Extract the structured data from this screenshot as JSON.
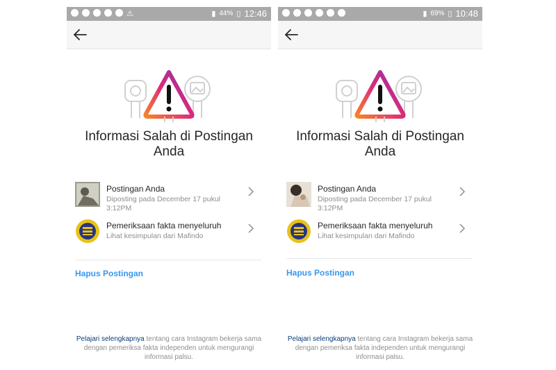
{
  "colors": {
    "statusbar": "#a9a9a9",
    "link_blue": "#3897f0",
    "text_dark": "#262626",
    "text_grey": "#8e8e8e",
    "warning_gradient": [
      "#f58529",
      "#dd2a7b",
      "#8134af"
    ]
  },
  "phones": [
    {
      "status": {
        "battery": "44%",
        "time": "12:46"
      },
      "icons": [
        "back-arrow-icon",
        "warning-triangle-icon",
        "chevron-right-icon"
      ],
      "title": "Informasi Salah di Postingan Anda",
      "post_row": {
        "title": "Postingan Anda",
        "subtitle": "Diposting pada December 17 pukul 3:12PM"
      },
      "factcheck_row": {
        "title": "Pemeriksaan fakta menyeluruh",
        "subtitle": "Lihat kesimpulan dari Mafindo"
      },
      "delete_label": "Hapus Postingan",
      "footer": {
        "link": "Pelajari selengkapnya",
        "text": "tentang cara Instagram bekerja sama dengan pemeriksa fakta independen untuk mengurangi informasi palsu."
      }
    },
    {
      "status": {
        "battery": "69%",
        "time": "10:48"
      },
      "icons": [
        "back-arrow-icon",
        "warning-triangle-icon",
        "chevron-right-icon"
      ],
      "title": "Informasi Salah di Postingan Anda",
      "post_row": {
        "title": "Postingan Anda",
        "subtitle": "Diposting pada December 17 pukul 3:12PM"
      },
      "factcheck_row": {
        "title": "Pemeriksaan fakta menyeluruh",
        "subtitle": "Lihat kesimpulan dari Mafindo"
      },
      "delete_label": "Hapus Postingan",
      "footer": {
        "link": "Pelajari selengkapnya",
        "text": "tentang cara Instagram bekerja sama dengan pemeriksa fakta independen untuk mengurangi informasi palsu."
      }
    }
  ]
}
